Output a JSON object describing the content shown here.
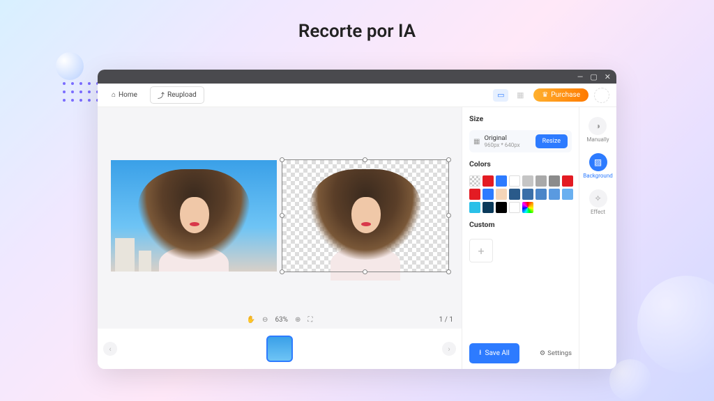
{
  "page": {
    "title": "Recorte por IA"
  },
  "titlebar": {
    "min": "—",
    "max": "▢",
    "close": "✕"
  },
  "toolbar": {
    "home": "Home",
    "reupload": "Reupload",
    "purchase": "Purchase"
  },
  "zoom": {
    "level": "63%",
    "page": "1 / 1"
  },
  "size": {
    "heading": "Size",
    "label": "Original",
    "dims": "960px * 640px",
    "resize": "Resize"
  },
  "colors": {
    "heading": "Colors",
    "swatches": [
      "checker",
      "#e31b23",
      "#2d7bff",
      "#ffffff",
      "#c5c5c5",
      "#a9a9a9",
      "#8b8b8b",
      "#e31b23",
      "#e31b23",
      "#2d7bff",
      "#f5d5b8",
      "#2a5a8a",
      "#3a6fa8",
      "#4a85c8",
      "#5a9ae0",
      "#6ab0f0",
      "#2ac0e8",
      "#0a3a5a",
      "#000000",
      "#ffffff",
      "rainbow"
    ]
  },
  "custom": {
    "heading": "Custom"
  },
  "footer": {
    "saveall": "Save All",
    "settings": "Settings"
  },
  "rail": {
    "manually": "Manually",
    "background": "Background",
    "effect": "Effect"
  }
}
